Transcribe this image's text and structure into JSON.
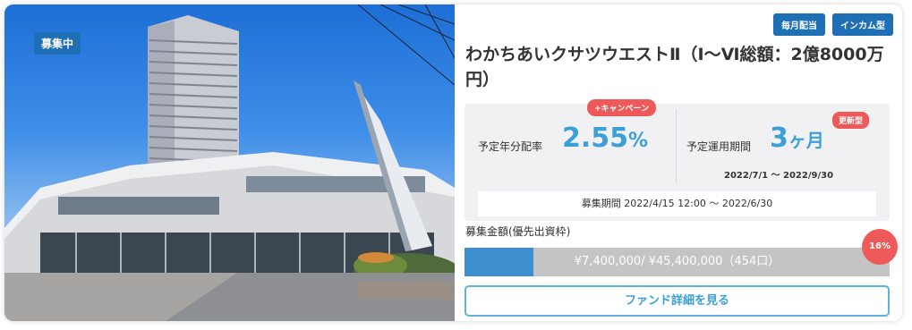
{
  "card": {
    "status_badge": "募集中",
    "tags": [
      "毎月配当",
      "インカム型"
    ],
    "title": "わかちあいクサツウエストⅡ（Ⅰ～Ⅵ総額：2億8000万円）",
    "yield": {
      "label": "予定年分配率",
      "value": "2.55",
      "unit": "%",
      "badge": "+キャンペーン"
    },
    "term": {
      "label": "予定運用期間",
      "value": "3",
      "unit": "ヶ月",
      "badge": "更新型",
      "range": "2022/7/1 ～ 2022/9/30"
    },
    "recruitment_period": "募集期間 2022/4/15 12:00 ～ 2022/6/30",
    "amount": {
      "label": "募集金額(優先出資枠)",
      "text": "¥7,400,000/ ¥45,400,000（454口）",
      "percent_label": "16%",
      "fraction": 0.163
    },
    "detail_button": "ファンド詳細を見る"
  },
  "colors": {
    "accent_blue": "#3ba0d8",
    "badge_blue": "#1e6fb5",
    "alert_red": "#ee5a5a",
    "progress_fill": "#3d8fcf",
    "progress_track": "#c4c4c4"
  }
}
